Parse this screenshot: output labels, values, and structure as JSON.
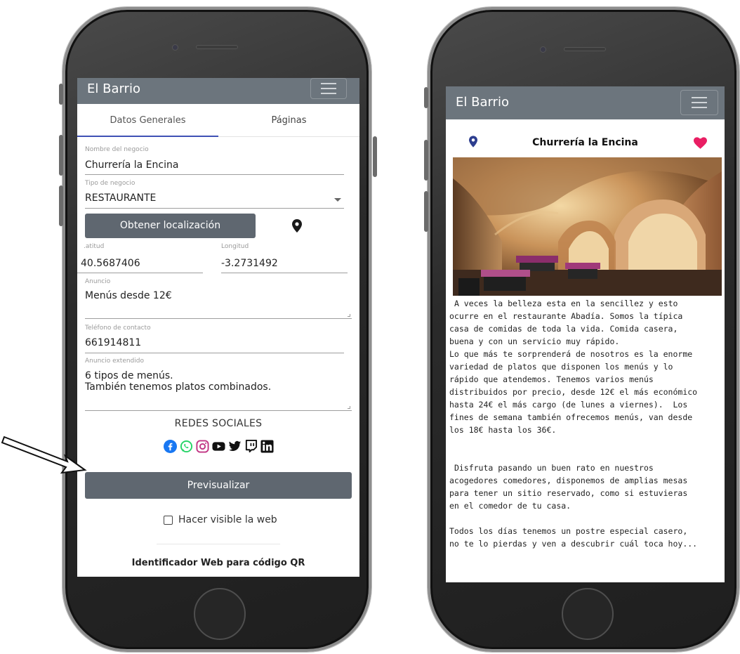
{
  "colors": {
    "navbar": "#6c757d",
    "button": "#5f6770",
    "tab_active_underline": "#3f51b5",
    "heart": "#e91e63",
    "location_pin_right": "#2d3e8f"
  },
  "editor": {
    "navbar": {
      "brand": "El Barrio"
    },
    "tabs": [
      {
        "label": "Datos Generales",
        "active": true
      },
      {
        "label": "Páginas",
        "active": false
      }
    ],
    "fields": {
      "business_name": {
        "label": "Nombre del negocio",
        "value": "Churrería la Encina"
      },
      "business_type": {
        "label": "Tipo de negocio",
        "value": "RESTAURANTE"
      },
      "latitude": {
        "label": ".atitud",
        "value": "40.5687406"
      },
      "longitude": {
        "label": "Longitud",
        "value": "-3.2731492"
      },
      "ad": {
        "label": "Anuncio",
        "value": "Menús desde 12€"
      },
      "phone": {
        "label": "Teléfono de contacto",
        "value": "661914811"
      },
      "extended_ad": {
        "label": "Anuncio extendido",
        "line1": "6 tipos de menús.",
        "line2": "También tenemos platos combinados."
      }
    },
    "location_button": "Obtener localización",
    "social_title": "REDES SOCIALES",
    "social_icons": [
      "facebook-icon",
      "whatsapp-icon",
      "instagram-icon",
      "youtube-icon",
      "twitter-icon",
      "twitch-icon",
      "linkedin-icon"
    ],
    "preview_button": "Previsualizar",
    "visible_checkbox": {
      "label": "Hacer visible la web",
      "checked": false
    },
    "qr_title": "Identificador Web para código QR"
  },
  "preview": {
    "navbar": {
      "brand": "El Barrio"
    },
    "business_title": "Churrería la Encina",
    "description": " A veces la belleza esta en la sencillez y esto\nocurre en el restaurante Abadía. Somos la típica\ncasa de comidas de toda la vida. Comida casera,\nbuena y con un servicio muy rápido.\nLo que más te sorprenderá de nosotros es la enorme\nvariedad de platos que disponen los menús y lo\nrápido que atendemos. Tenemos varios menús\ndistribuidos por precio, desde 12€ el más económico\nhasta 24€ el más cargo (de lunes a viernes).  Los\nfines de semana también ofrecemos menús, van desde\nlos 18€ hasta los 36€.\n\n\n Disfruta pasando un buen rato en nuestros\nacogedores comedores, disponemos de amplias mesas\npara tener un sitio reservado, como si estuvieras\nen el comedor de tu casa.\n\nTodos los días tenemos un postre especial casero,\nno te lo pierdas y ven a descubrir cuál toca hoy..."
  }
}
